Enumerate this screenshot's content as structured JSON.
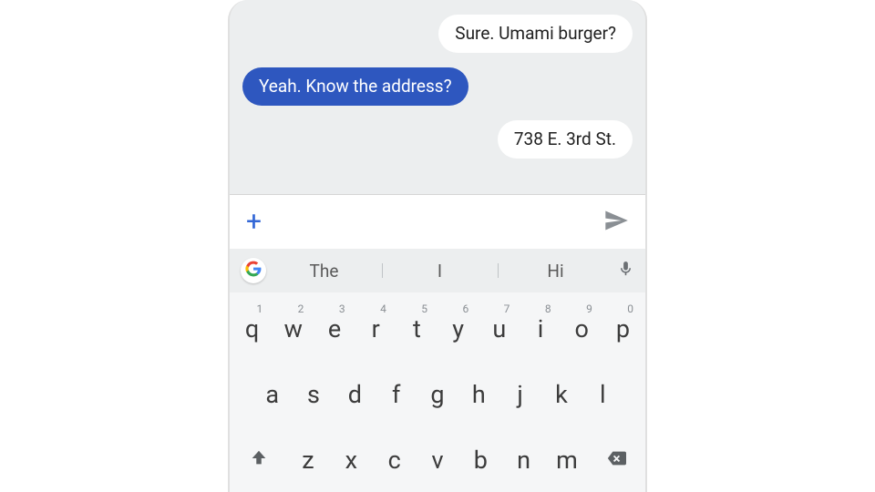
{
  "chat": {
    "messages": [
      {
        "side": "right",
        "style": "white",
        "text": "Sure. Umami burger?"
      },
      {
        "side": "left",
        "style": "blue",
        "text": "Yeah. Know the address?"
      },
      {
        "side": "right",
        "style": "white",
        "text": "738 E. 3rd St."
      }
    ]
  },
  "composer": {
    "plus": "+"
  },
  "suggestions": {
    "items": [
      "The",
      "I",
      "Hi"
    ]
  },
  "keyboard": {
    "row1": [
      {
        "k": "q",
        "n": "1"
      },
      {
        "k": "w",
        "n": "2"
      },
      {
        "k": "e",
        "n": "3"
      },
      {
        "k": "r",
        "n": "4"
      },
      {
        "k": "t",
        "n": "5"
      },
      {
        "k": "y",
        "n": "6"
      },
      {
        "k": "u",
        "n": "7"
      },
      {
        "k": "i",
        "n": "8"
      },
      {
        "k": "o",
        "n": "9"
      },
      {
        "k": "p",
        "n": "0"
      }
    ],
    "row2": [
      {
        "k": "a"
      },
      {
        "k": "s"
      },
      {
        "k": "d"
      },
      {
        "k": "f"
      },
      {
        "k": "g"
      },
      {
        "k": "h"
      },
      {
        "k": "j"
      },
      {
        "k": "k"
      },
      {
        "k": "l"
      }
    ],
    "row3": [
      {
        "k": "z"
      },
      {
        "k": "x"
      },
      {
        "k": "c"
      },
      {
        "k": "v"
      },
      {
        "k": "b"
      },
      {
        "k": "n"
      },
      {
        "k": "m"
      }
    ]
  }
}
